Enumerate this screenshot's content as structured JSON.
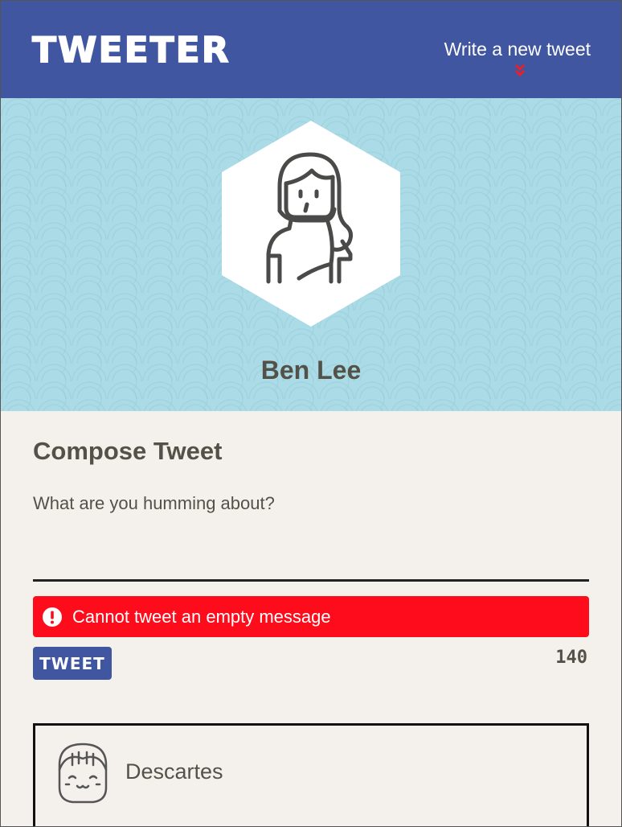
{
  "nav": {
    "brand": "TWEETER",
    "write_link": "Write a new tweet",
    "icon": "double-chevron-down-icon"
  },
  "header": {
    "username": "Ben Lee",
    "avatar_icon": "female-user-avatar"
  },
  "compose": {
    "title": "Compose Tweet",
    "placeholder": "What are you humming about?",
    "value": "",
    "error": {
      "icon": "exclamation-circle-icon",
      "message": "Cannot tweet an empty message"
    },
    "button_label": "TWEET",
    "counter": "140"
  },
  "tweets": [
    {
      "name": "Descartes",
      "avatar_icon": "girl-avatar"
    }
  ],
  "colors": {
    "nav_bg": "#4056a1",
    "header_bg": "#aadbe6",
    "page_bg": "#f4f1ec",
    "error_bg": "#fe0c1b",
    "text": "#545149",
    "accent_red": "#e8202a"
  }
}
